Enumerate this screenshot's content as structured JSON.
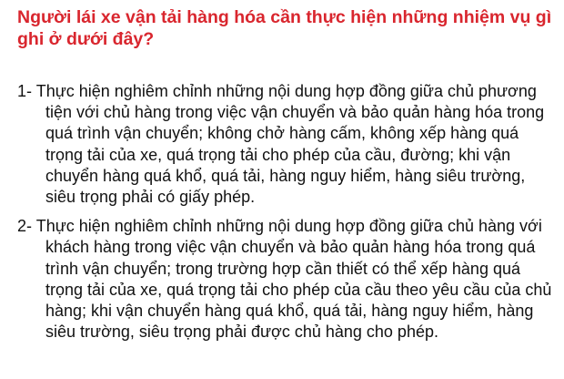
{
  "question": {
    "text": "Người lái xe vận tải hàng hóa cần thực hiện những nhiệm vụ gì ghi ở dưới đây?",
    "color": "#d9262e"
  },
  "options": [
    {
      "number": "1-",
      "text": "Thực hiện nghiêm chỉnh những nội dung hợp đồng giữa chủ phương tiện với chủ hàng trong việc vận chuyển và bảo quản hàng hóa trong quá trình vận chuyển; không chở hàng cấm, không xếp hàng quá trọng tải của xe, quá trọng tải cho phép của cầu, đường; khi vận chuyển hàng quá khổ, quá tải, hàng nguy hiểm, hàng siêu trường, siêu trọng phải có giấy phép."
    },
    {
      "number": "2-",
      "text": "Thực hiện nghiêm chỉnh những nội dung hợp đồng giữa chủ hàng với khách hàng trong việc vận chuyển và bảo quản hàng hóa trong quá trình vận chuyển; trong trường hợp cần thiết có thể xếp hàng quá trọng tải của xe, quá trọng tải cho phép của cầu theo yêu cầu của chủ hàng; khi vận chuyển hàng quá khổ, quá tải, hàng nguy hiểm, hàng siêu trường, siêu trọng phải được chủ hàng cho phép."
    }
  ]
}
